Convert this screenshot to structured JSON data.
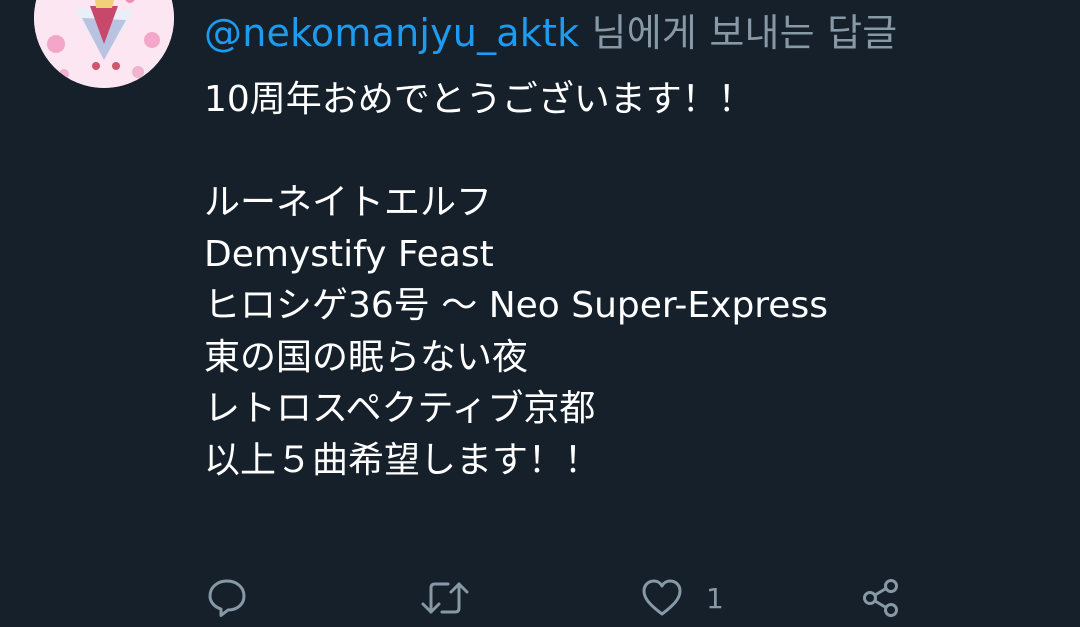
{
  "reply": {
    "handle": "@nekomanjyu_aktk",
    "suffix": " 님에게 보내는 답글"
  },
  "tweet": {
    "lines": [
      "10周年おめでとうございます！！",
      "",
      "ルーネイトエルフ",
      "Demystify Feast",
      "ヒロシゲ36号 ～ Neo Super-Express",
      "東の国の眠らない夜",
      "レトロスペクティブ京都",
      "以上５曲希望します！！"
    ]
  },
  "actions": {
    "reply_icon": "comment-icon",
    "retweet_icon": "retweet-icon",
    "like_icon": "heart-icon",
    "like_count": "1",
    "share_icon": "share-icon"
  },
  "colors": {
    "background": "#15202b",
    "text": "#ffffff",
    "muted": "#8899a6",
    "accent": "#1d9bf0"
  }
}
